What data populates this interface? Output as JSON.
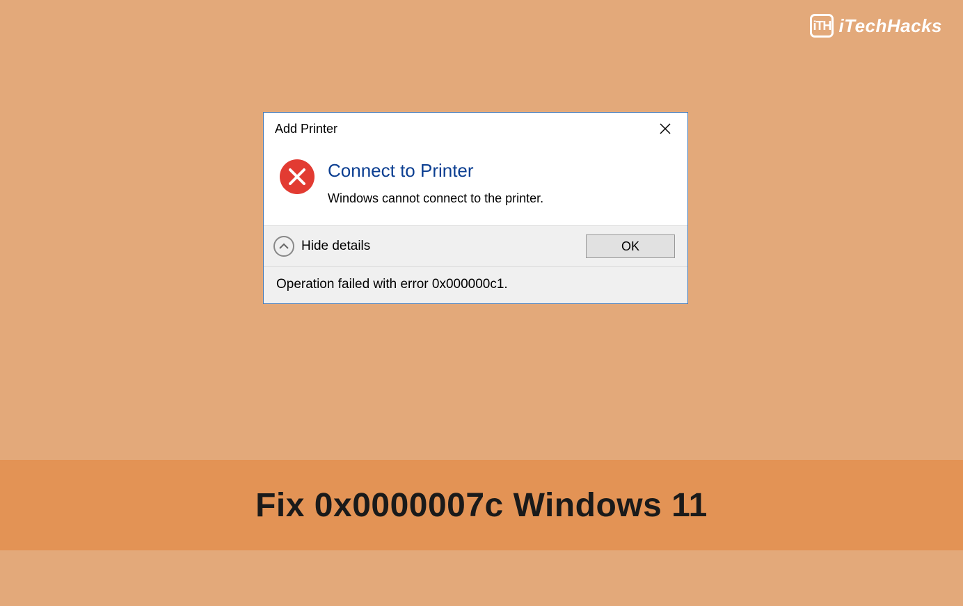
{
  "brand": {
    "icon_text": "iTH",
    "name": "iTechHacks"
  },
  "dialog": {
    "title": "Add Printer",
    "heading": "Connect to Printer",
    "message": "Windows cannot connect to the printer.",
    "details_toggle": "Hide details",
    "ok_label": "OK",
    "details_text": "Operation failed with error 0x000000c1."
  },
  "banner": {
    "text": "Fix 0x0000007c Windows 11"
  }
}
